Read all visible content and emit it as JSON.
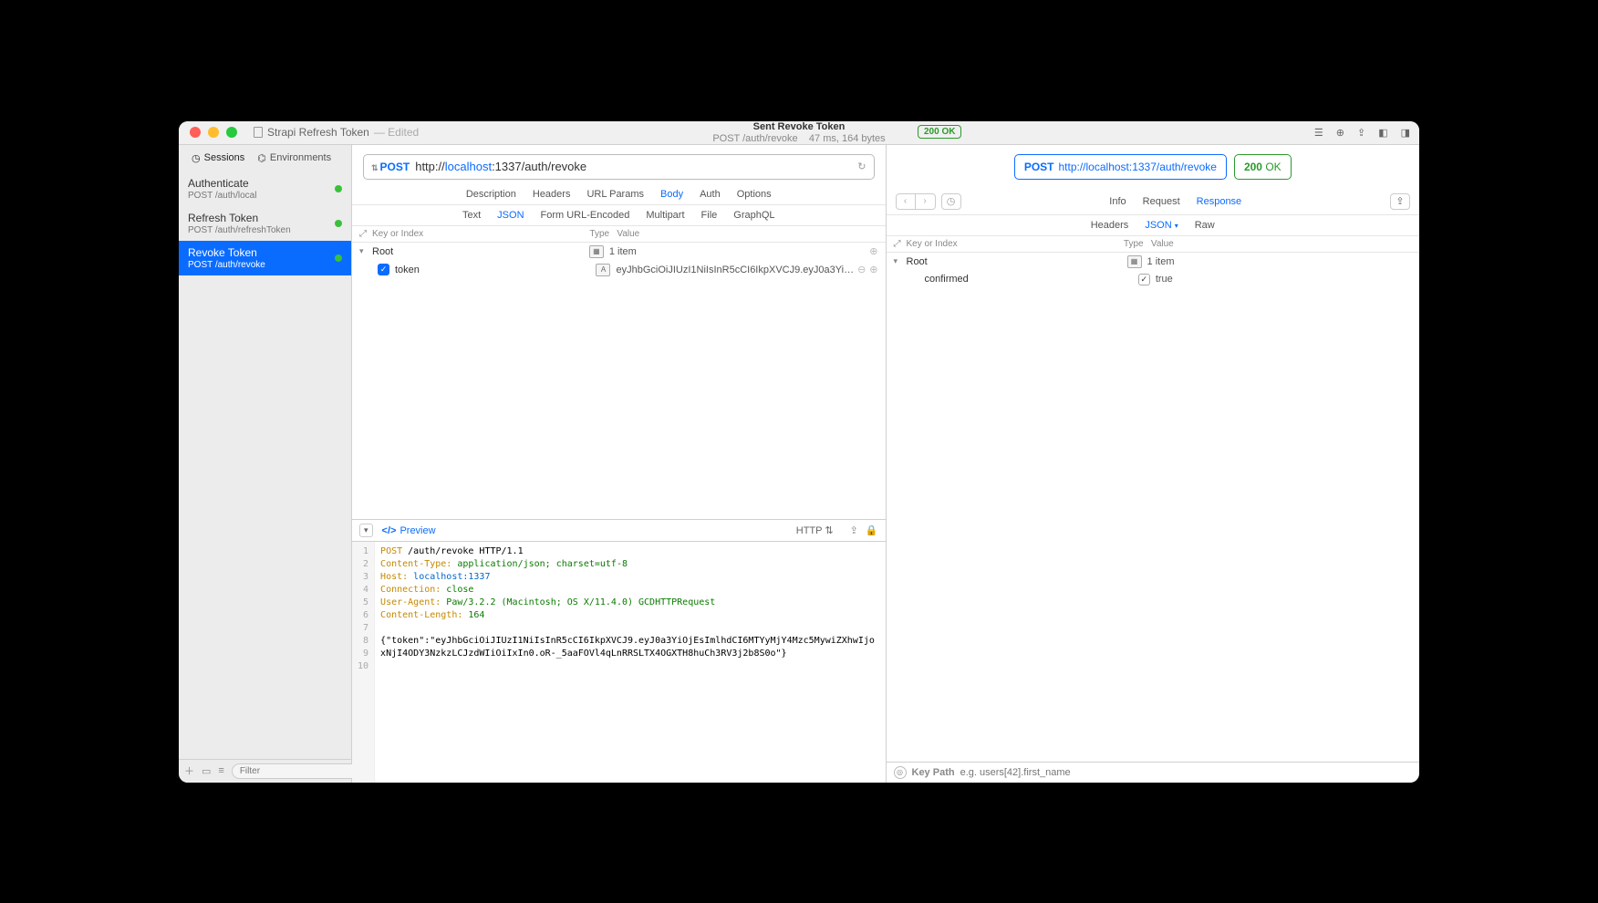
{
  "window": {
    "project": "Strapi Refresh Token",
    "edited": "— Edited",
    "center_title": "Sent Revoke Token",
    "center_sub": "POST /auth/revoke",
    "center_meta": "47 ms, 164 bytes",
    "status_badge": "200 OK"
  },
  "sidebar": {
    "tab_sessions": "Sessions",
    "tab_environments": "Environments",
    "items": [
      {
        "name": "Authenticate",
        "path": "POST /auth/local"
      },
      {
        "name": "Refresh Token",
        "path": "POST /auth/refreshToken"
      },
      {
        "name": "Revoke Token",
        "path": "POST /auth/revoke"
      }
    ],
    "filter_placeholder": "Filter"
  },
  "request": {
    "method": "POST",
    "url_prefix": "http://",
    "url_host": "localhost",
    "url_port_path": ":1337/auth/revoke",
    "tabs": {
      "description": "Description",
      "headers": "Headers",
      "url_params": "URL Params",
      "body": "Body",
      "auth": "Auth",
      "options": "Options"
    },
    "subtabs": {
      "text": "Text",
      "json": "JSON",
      "form": "Form URL-Encoded",
      "multipart": "Multipart",
      "file": "File",
      "graphql": "GraphQL"
    },
    "table": {
      "h_key": "Key or Index",
      "h_type": "Type",
      "h_value": "Value",
      "root": "Root",
      "root_val": "1 item",
      "row1_key": "token",
      "row1_val": "eyJhbGciOiJIUzI1NiIsInR5cCI6IkpXVCJ9.eyJ0a3YiOjE..."
    },
    "preview": {
      "label": "Preview",
      "http": "HTTP",
      "lines": [
        {
          "n": "1",
          "kw": "POST",
          "rest": " /auth/revoke HTTP/1.1"
        },
        {
          "n": "2",
          "kw": "Content-Type:",
          "val": " application/json; charset=utf-8"
        },
        {
          "n": "3",
          "kw": "Host:",
          "url": " localhost:1337"
        },
        {
          "n": "4",
          "kw": "Connection:",
          "val": " close"
        },
        {
          "n": "5",
          "kw": "User-Agent:",
          "val": " Paw/3.2.2 (Macintosh; OS X/11.4.0) GCDHTTPRequest"
        },
        {
          "n": "6",
          "kw": "Content-Length:",
          "num": " 164"
        },
        {
          "n": "7",
          "rest": ""
        },
        {
          "n": "8",
          "rest": "{\"token\":\"eyJhbGciOiJIUzI1NiIsInR5cCI6IkpXVCJ9.eyJ0a3YiOjEsImlhdCI6MTYyMjY4Mzc5MywiZXhwIjoxNjI4ODY3NzkzLCJzdWIiOiIxIn0.oR-_5aaFOVl4qLnRRSLTX4OGXTH8huCh3RV3j2b8S0o\"}"
        },
        {
          "n": "9",
          "rest": ""
        },
        {
          "n": "10",
          "rest": ""
        }
      ]
    }
  },
  "response": {
    "method": "POST",
    "url": "http://localhost:1337/auth/revoke",
    "status": "200",
    "status_text": "OK",
    "tabs": {
      "info": "Info",
      "request": "Request",
      "response": "Response"
    },
    "subtabs": {
      "headers": "Headers",
      "json": "JSON",
      "raw": "Raw"
    },
    "table": {
      "h_key": "Key or Index",
      "h_type": "Type",
      "h_value": "Value",
      "root": "Root",
      "root_val": "1 item",
      "row1_key": "confirmed",
      "row1_val": "true"
    },
    "keypath_label": "Key Path",
    "keypath_placeholder": "e.g. users[42].first_name"
  }
}
